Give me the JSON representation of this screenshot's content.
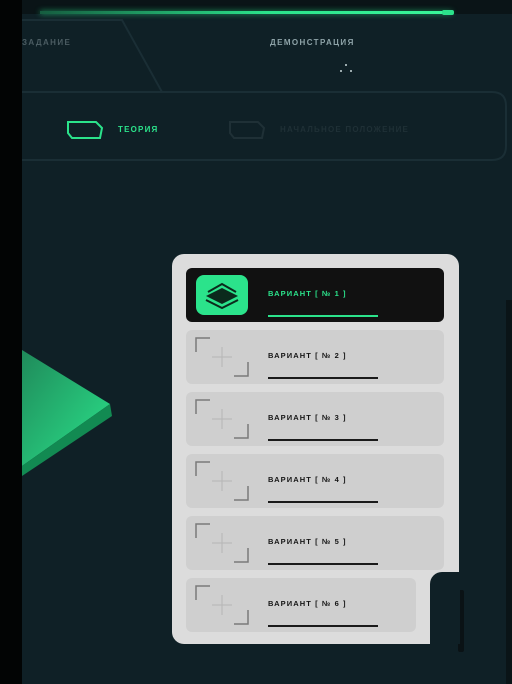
{
  "colors": {
    "accent": "#2be38b",
    "panel": "#0f2026",
    "card": "#dcdcdc",
    "active_row": "#111111"
  },
  "tabs": {
    "left_label": "ЗАДАНИЕ",
    "demo_label": "ДЕМОНСТРАЦИЯ"
  },
  "modes": {
    "theory_label": "ТЕОРИЯ",
    "practice_label": "НАЧАЛЬНОЕ ПОЛОЖЕНИЕ"
  },
  "icons": {
    "theory": "folder-tab-icon",
    "practice": "folder-tab-icon",
    "demo_dots": "dots-icon",
    "play": "play-arrow-icon",
    "active_thumb": "layers-icon",
    "empty_thumb": "crosshair-icon"
  },
  "variants": [
    {
      "label": "ВАРИАНТ [ № 1 ]",
      "active": true
    },
    {
      "label": "ВАРИАНТ [ № 2 ]",
      "active": false
    },
    {
      "label": "ВАРИАНТ [ № 3 ]",
      "active": false
    },
    {
      "label": "ВАРИАНТ [ № 4 ]",
      "active": false
    },
    {
      "label": "ВАРИАНТ [ № 5 ]",
      "active": false
    },
    {
      "label": "ВАРИАНТ [ № 6 ]",
      "active": false
    }
  ]
}
